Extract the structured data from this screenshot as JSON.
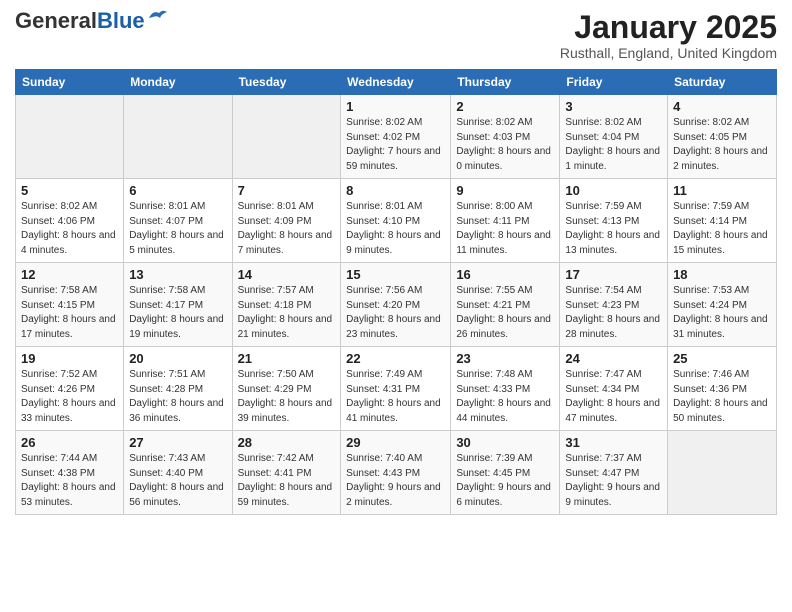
{
  "header": {
    "logo_general": "General",
    "logo_blue": "Blue",
    "month": "January 2025",
    "location": "Rusthall, England, United Kingdom"
  },
  "weekdays": [
    "Sunday",
    "Monday",
    "Tuesday",
    "Wednesday",
    "Thursday",
    "Friday",
    "Saturday"
  ],
  "weeks": [
    [
      {
        "num": "",
        "info": ""
      },
      {
        "num": "",
        "info": ""
      },
      {
        "num": "",
        "info": ""
      },
      {
        "num": "1",
        "info": "Sunrise: 8:02 AM\nSunset: 4:02 PM\nDaylight: 7 hours and 59 minutes."
      },
      {
        "num": "2",
        "info": "Sunrise: 8:02 AM\nSunset: 4:03 PM\nDaylight: 8 hours and 0 minutes."
      },
      {
        "num": "3",
        "info": "Sunrise: 8:02 AM\nSunset: 4:04 PM\nDaylight: 8 hours and 1 minute."
      },
      {
        "num": "4",
        "info": "Sunrise: 8:02 AM\nSunset: 4:05 PM\nDaylight: 8 hours and 2 minutes."
      }
    ],
    [
      {
        "num": "5",
        "info": "Sunrise: 8:02 AM\nSunset: 4:06 PM\nDaylight: 8 hours and 4 minutes."
      },
      {
        "num": "6",
        "info": "Sunrise: 8:01 AM\nSunset: 4:07 PM\nDaylight: 8 hours and 5 minutes."
      },
      {
        "num": "7",
        "info": "Sunrise: 8:01 AM\nSunset: 4:09 PM\nDaylight: 8 hours and 7 minutes."
      },
      {
        "num": "8",
        "info": "Sunrise: 8:01 AM\nSunset: 4:10 PM\nDaylight: 8 hours and 9 minutes."
      },
      {
        "num": "9",
        "info": "Sunrise: 8:00 AM\nSunset: 4:11 PM\nDaylight: 8 hours and 11 minutes."
      },
      {
        "num": "10",
        "info": "Sunrise: 7:59 AM\nSunset: 4:13 PM\nDaylight: 8 hours and 13 minutes."
      },
      {
        "num": "11",
        "info": "Sunrise: 7:59 AM\nSunset: 4:14 PM\nDaylight: 8 hours and 15 minutes."
      }
    ],
    [
      {
        "num": "12",
        "info": "Sunrise: 7:58 AM\nSunset: 4:15 PM\nDaylight: 8 hours and 17 minutes."
      },
      {
        "num": "13",
        "info": "Sunrise: 7:58 AM\nSunset: 4:17 PM\nDaylight: 8 hours and 19 minutes."
      },
      {
        "num": "14",
        "info": "Sunrise: 7:57 AM\nSunset: 4:18 PM\nDaylight: 8 hours and 21 minutes."
      },
      {
        "num": "15",
        "info": "Sunrise: 7:56 AM\nSunset: 4:20 PM\nDaylight: 8 hours and 23 minutes."
      },
      {
        "num": "16",
        "info": "Sunrise: 7:55 AM\nSunset: 4:21 PM\nDaylight: 8 hours and 26 minutes."
      },
      {
        "num": "17",
        "info": "Sunrise: 7:54 AM\nSunset: 4:23 PM\nDaylight: 8 hours and 28 minutes."
      },
      {
        "num": "18",
        "info": "Sunrise: 7:53 AM\nSunset: 4:24 PM\nDaylight: 8 hours and 31 minutes."
      }
    ],
    [
      {
        "num": "19",
        "info": "Sunrise: 7:52 AM\nSunset: 4:26 PM\nDaylight: 8 hours and 33 minutes."
      },
      {
        "num": "20",
        "info": "Sunrise: 7:51 AM\nSunset: 4:28 PM\nDaylight: 8 hours and 36 minutes."
      },
      {
        "num": "21",
        "info": "Sunrise: 7:50 AM\nSunset: 4:29 PM\nDaylight: 8 hours and 39 minutes."
      },
      {
        "num": "22",
        "info": "Sunrise: 7:49 AM\nSunset: 4:31 PM\nDaylight: 8 hours and 41 minutes."
      },
      {
        "num": "23",
        "info": "Sunrise: 7:48 AM\nSunset: 4:33 PM\nDaylight: 8 hours and 44 minutes."
      },
      {
        "num": "24",
        "info": "Sunrise: 7:47 AM\nSunset: 4:34 PM\nDaylight: 8 hours and 47 minutes."
      },
      {
        "num": "25",
        "info": "Sunrise: 7:46 AM\nSunset: 4:36 PM\nDaylight: 8 hours and 50 minutes."
      }
    ],
    [
      {
        "num": "26",
        "info": "Sunrise: 7:44 AM\nSunset: 4:38 PM\nDaylight: 8 hours and 53 minutes."
      },
      {
        "num": "27",
        "info": "Sunrise: 7:43 AM\nSunset: 4:40 PM\nDaylight: 8 hours and 56 minutes."
      },
      {
        "num": "28",
        "info": "Sunrise: 7:42 AM\nSunset: 4:41 PM\nDaylight: 8 hours and 59 minutes."
      },
      {
        "num": "29",
        "info": "Sunrise: 7:40 AM\nSunset: 4:43 PM\nDaylight: 9 hours and 2 minutes."
      },
      {
        "num": "30",
        "info": "Sunrise: 7:39 AM\nSunset: 4:45 PM\nDaylight: 9 hours and 6 minutes."
      },
      {
        "num": "31",
        "info": "Sunrise: 7:37 AM\nSunset: 4:47 PM\nDaylight: 9 hours and 9 minutes."
      },
      {
        "num": "",
        "info": ""
      }
    ]
  ]
}
